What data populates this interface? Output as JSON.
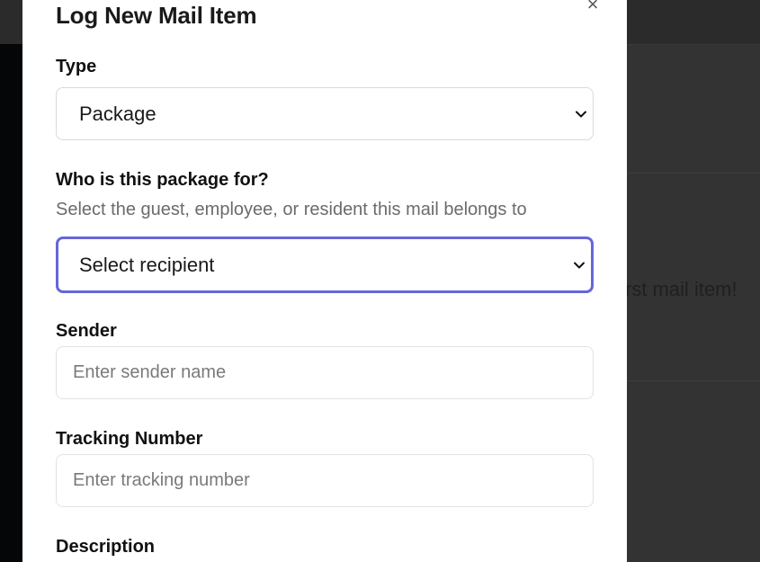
{
  "background": {
    "empty_state_text": "irst mail item!"
  },
  "modal": {
    "title": "Log New Mail Item",
    "close_label": "×",
    "type_field": {
      "label": "Type",
      "value": "Package"
    },
    "recipient_field": {
      "label": "Who is this package for?",
      "help": "Select the guest, employee, or resident this mail belongs to",
      "value": "Select recipient"
    },
    "sender_field": {
      "label": "Sender",
      "placeholder": "Enter sender name"
    },
    "tracking_field": {
      "label": "Tracking Number",
      "placeholder": "Enter tracking number"
    },
    "description_field": {
      "label": "Description"
    }
  },
  "colors": {
    "focus_ring": "#6666d8",
    "backdrop": "#333333"
  }
}
